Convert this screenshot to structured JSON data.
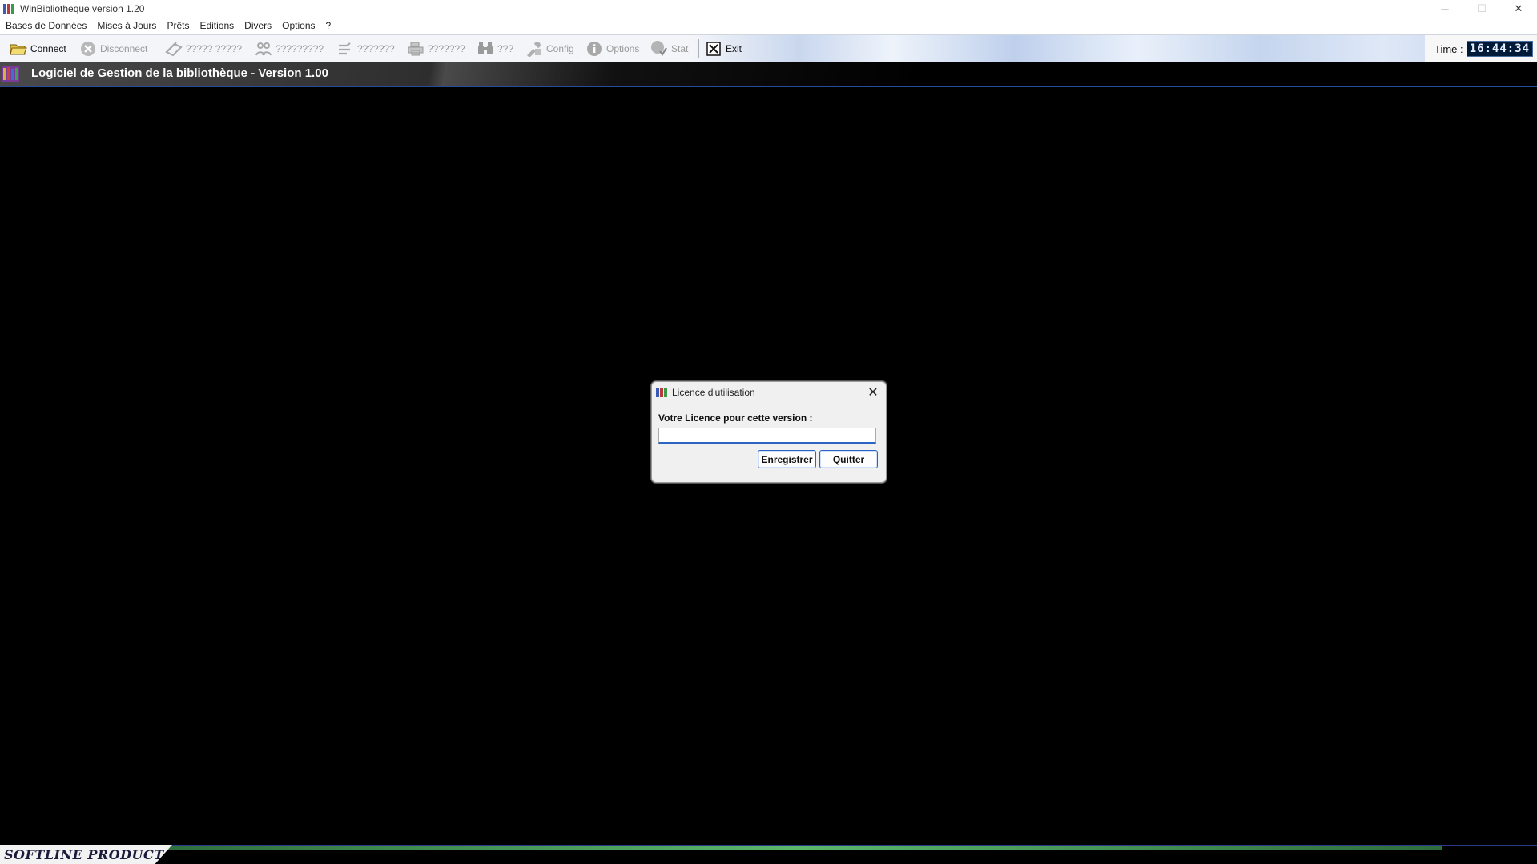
{
  "window": {
    "title": "WinBibliotheque version 1.20",
    "controls": {
      "minimize": "─",
      "maximize": "☐",
      "close": "✕"
    }
  },
  "menubar": {
    "items": [
      "Bases de Données",
      "Mises à Jours",
      "Prêts",
      "Editions",
      "Divers",
      "Options",
      "?"
    ]
  },
  "toolbar": {
    "connect": "Connect",
    "disconnect": "Disconnect",
    "b1": "????? ?????",
    "b2": "?????????",
    "b3": "???????",
    "b4": "???????",
    "b5": "???",
    "config": "Config",
    "options": "Options",
    "stat": "Stat",
    "exit": "Exit",
    "time_label": "Time :",
    "time_value": "16:44:34"
  },
  "caption": {
    "title": "Logiciel de Gestion de la bibliothèque -  Version 1.00"
  },
  "dialog": {
    "title": "Licence d'utilisation",
    "label": "Votre Licence pour cette version :",
    "input_value": "",
    "register_button": "Enregistrer",
    "quit_button": "Quitter"
  },
  "footer": {
    "brand": "SOFTLINE PRODUCT"
  },
  "colors": {
    "accent": "#2d64c4",
    "background": "#000000",
    "progress": "#5ab86a"
  }
}
